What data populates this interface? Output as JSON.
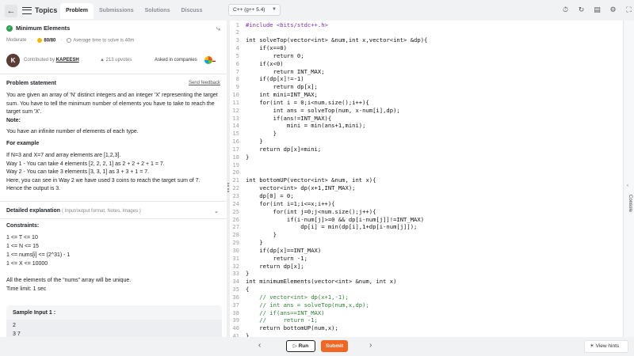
{
  "topbar": {
    "back_icon": "arrow-left-icon",
    "topics_label": "Topics",
    "tabs": [
      {
        "label": "Problem",
        "active": true
      },
      {
        "label": "Submissions",
        "active": false
      },
      {
        "label": "Solutions",
        "active": false
      },
      {
        "label": "Discuss",
        "active": false
      }
    ],
    "language": "C++ (g++ 5.4)",
    "right_icons": [
      "timer-icon",
      "refresh-icon",
      "document-icon",
      "settings-icon",
      "fullscreen-icon"
    ]
  },
  "problem": {
    "title": "Minimum Elements",
    "difficulty": "Moderate",
    "score": "80/80",
    "avg_time": "Average time to solve is 40m",
    "avatar_letter": "K",
    "contributed_by": "Contributed by",
    "author": "KAPEESH",
    "upvotes": "213 upvotes",
    "asked_in": "Asked in companies",
    "statement_heading": "Problem statement",
    "send_feedback": "Send feedback",
    "statement": "You are given an array of 'N' distinct integers and an integer 'X' representing the target sum. You have to tell the minimum number of elements you have to take to reach the target sum 'X'.",
    "note_heading": "Note:",
    "note": "You have an infinite number of elements of each type.",
    "example_heading": "For example",
    "example_lines": [
      "If N=3 and X=7 and array elements are [1,2,3].",
      "Way 1 - You can take 4 elements  [2, 2, 2, 1] as 2 + 2 + 2 + 1 = 7.",
      "Way 2 - You can take 3 elements  [3, 3, 1] as 3 + 3 + 1 = 7.",
      "Here, you can see in Way 2 we have used 3 coins to reach the target sum of 7.",
      "Hence the output is 3."
    ],
    "detailed_heading": "Detailed explanation",
    "detailed_note": "( Input/output format, Notes, Images )",
    "constraints_heading": "Constraints:",
    "constraints": [
      "1 <= T <= 10",
      "1 <= N <= 15",
      "1 <= nums[i] <= (2^31) - 1",
      "1 <= X <= 10000"
    ],
    "unique_note": "All the elements of the “nums” array will be unique.",
    "time_limit": "Time limit: 1 sec",
    "sample_heading": "Sample Input 1 :",
    "sample_lines": [
      "2",
      "3 7"
    ]
  },
  "editor": {
    "lines": [
      "#include <bits/stdc++.h>",
      "",
      "int solveTop(vector<int> &num,int x,vector<int> &dp){",
      "    if(x==0)",
      "        return 0;",
      "    if(x<0)",
      "        return INT_MAX;",
      "    if(dp[x]!=-1)",
      "        return dp[x];",
      "    int mini=INT_MAX;",
      "    for(int i = 0;i<num.size();i++){",
      "        int ans = solveTop(num, x-num[i],dp);",
      "        if(ans!=INT_MAX){",
      "            mini = min(ans+1,mini);",
      "        }",
      "    }",
      "    return dp[x]=mini;",
      "}",
      "",
      "",
      "int bottomUP(vector<int> &num, int x){",
      "    vector<int> dp(x+1,INT_MAX);",
      "    dp[0] = 0;",
      "    for(int i=1;i<=x;i++){",
      "        for(int j=0;j<num.size();j++){",
      "            if(i-num[j]>=0 && dp[i-num[j]]!=INT_MAX)",
      "                dp[i] = min(dp[i],1+dp[i-num[j]]);",
      "        }",
      "    }",
      "    if(dp[x]==INT_MAX)",
      "        return -1;",
      "    return dp[x];",
      "}",
      "int minimumElements(vector<int> &num, int x)",
      "{",
      "    // vector<int> dp(x+1,-1);",
      "    // int ans = solveTop(num,x,dp);",
      "    // if(ans==INT_MAX)",
      "    //     return -1;",
      "    return bottomUP(num,x);",
      "}"
    ]
  },
  "console_label": "Console",
  "bottombar": {
    "run_label": "Run",
    "submit_label": "Submit",
    "hints_label": "View hints"
  },
  "colors": {
    "submit": "#f26522",
    "keyword": "#1a1aa6",
    "comment": "#2e7d32",
    "number": "#c2185b",
    "preproc": "#7b2fa8"
  }
}
